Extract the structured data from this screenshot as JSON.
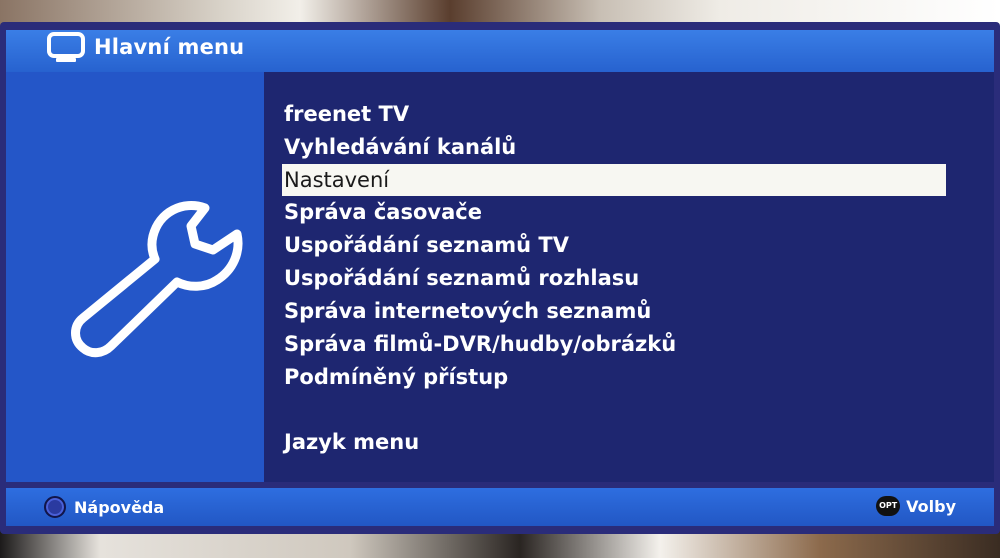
{
  "header": {
    "title": "Hlavní menu",
    "icon": "tv-icon"
  },
  "sidebar": {
    "icon": "wrench-icon"
  },
  "menu": {
    "items": [
      "freenet TV",
      "Vyhledávání kanálů",
      "Nastavení",
      "Správa časovače",
      "Uspořádání seznamů TV",
      "Uspořádání seznamů rozhlasu",
      "Správa internetových seznamů",
      "Správa filmů-DVR/hudby/obrázků",
      "Podmíněný přístup",
      "Jazyk menu"
    ],
    "selected": "Nastavení"
  },
  "footer": {
    "help_label": "Nápověda",
    "options_badge": "OPT",
    "options_label": "Volby"
  },
  "colors": {
    "header_blue": "#2762cf",
    "panel_blue": "#2456c8",
    "background_navy": "#1e2670",
    "selection": "#f7f7f2"
  }
}
